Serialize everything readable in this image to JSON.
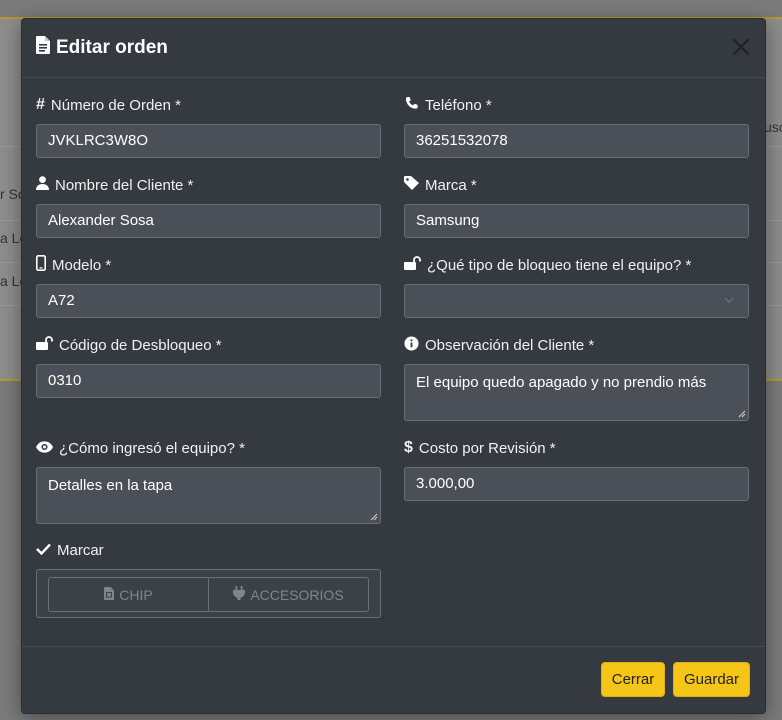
{
  "background": {
    "frag_1": "usc",
    "frag_2": "r So",
    "frag_3": "a Lo",
    "frag_4": "a Lo"
  },
  "modal": {
    "title": "Editar orden",
    "fields": {
      "order_number": {
        "label": "Número de Orden *",
        "value": "JVKLRC3W8O"
      },
      "phone": {
        "label": "Teléfono *",
        "value": "36251532078"
      },
      "client_name": {
        "label": "Nombre del Cliente *",
        "value": "Alexander Sosa"
      },
      "brand": {
        "label": "Marca *",
        "value": "Samsung"
      },
      "model": {
        "label": "Modelo *",
        "value": "A72"
      },
      "lock_type": {
        "label": "¿Qué tipo de bloqueo tiene el equipo? *",
        "value": ""
      },
      "unlock_code": {
        "label": "Código de Desbloqueo *",
        "value": "0310"
      },
      "observation": {
        "label": "Observación del Cliente *",
        "value": "El equipo quedo apagado y no prendio más"
      },
      "entry_condition": {
        "label": "¿Cómo ingresó el equipo? *",
        "value": "Detalles en la tapa"
      },
      "review_cost": {
        "label": "Costo por Revisión *",
        "value": "3.000,00"
      }
    },
    "marcar": {
      "label": "Marcar",
      "chip_label": "CHIP",
      "accessories_label": "ACCESORIOS"
    },
    "footer": {
      "close_label": "Cerrar",
      "save_label": "Guardar"
    }
  },
  "colors": {
    "modal_bg": "#353a41",
    "input_bg": "#4b5058",
    "accent": "#f5c518"
  },
  "icons": [
    "file-icon",
    "close-icon",
    "hash-icon",
    "phone-icon",
    "user-icon",
    "tag-icon",
    "mobile-icon",
    "unlock-icon",
    "info-icon",
    "eye-icon",
    "dollar-icon",
    "check-icon",
    "sim-card-icon",
    "plug-icon",
    "chevron-down-icon"
  ]
}
